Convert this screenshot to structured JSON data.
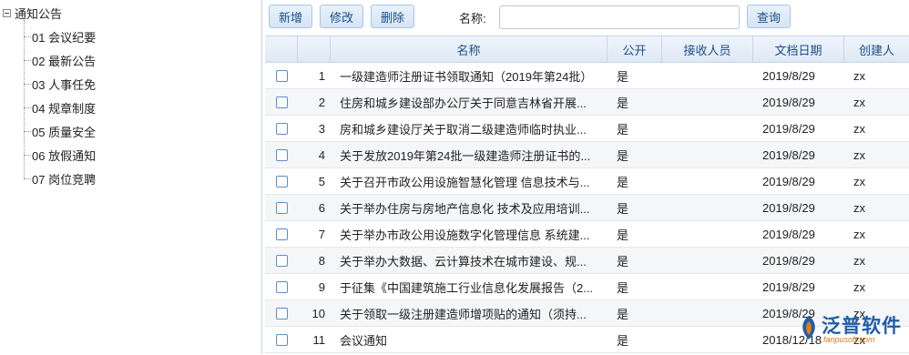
{
  "tree": {
    "root_label": "通知公告",
    "items": [
      "01 会议纪要",
      "02 最新公告",
      "03 人事任免",
      "04 规章制度",
      "05 质量安全",
      "06 放假通知",
      "07 岗位竞聘"
    ]
  },
  "toolbar": {
    "add_label": "新增",
    "edit_label": "修改",
    "delete_label": "删除",
    "name_label": "名称:",
    "name_value": "",
    "query_label": "查询"
  },
  "grid": {
    "columns": [
      "名称",
      "公开",
      "接收人员",
      "文档日期",
      "创建人"
    ],
    "rows": [
      {
        "no": "1",
        "name": "一级建造师注册证书领取通知（2019年第24批）",
        "public": "是",
        "recipients": "",
        "date": "2019/8/29",
        "creator": "zx"
      },
      {
        "no": "2",
        "name": "住房和城乡建设部办公厅关于同意吉林省开展...",
        "public": "是",
        "recipients": "",
        "date": "2019/8/29",
        "creator": "zx"
      },
      {
        "no": "3",
        "name": "房和城乡建设厅关于取消二级建造师临时执业...",
        "public": "是",
        "recipients": "",
        "date": "2019/8/29",
        "creator": "zx"
      },
      {
        "no": "4",
        "name": "关于发放2019年第24批一级建造师注册证书的...",
        "public": "是",
        "recipients": "",
        "date": "2019/8/29",
        "creator": "zx"
      },
      {
        "no": "5",
        "name": "关于召开市政公用设施智慧化管理 信息技术与...",
        "public": "是",
        "recipients": "",
        "date": "2019/8/29",
        "creator": "zx"
      },
      {
        "no": "6",
        "name": "关于举办住房与房地产信息化 技术及应用培训...",
        "public": "是",
        "recipients": "",
        "date": "2019/8/29",
        "creator": "zx"
      },
      {
        "no": "7",
        "name": "关于举办市政公用设施数字化管理信息 系统建...",
        "public": "是",
        "recipients": "",
        "date": "2019/8/29",
        "creator": "zx"
      },
      {
        "no": "8",
        "name": "关于举办大数据、云计算技术在城市建设、规...",
        "public": "是",
        "recipients": "",
        "date": "2019/8/29",
        "creator": "zx"
      },
      {
        "no": "9",
        "name": "于征集《中国建筑施工行业信息化发展报告（2...",
        "public": "是",
        "recipients": "",
        "date": "2019/8/29",
        "creator": "zx"
      },
      {
        "no": "10",
        "name": "关于领取一级注册建造师增项贴的通知（须持...",
        "public": "是",
        "recipients": "",
        "date": "2019/8/29",
        "creator": "zx"
      },
      {
        "no": "11",
        "name": "会议通知",
        "public": "是",
        "recipients": "",
        "date": "2018/12/18",
        "creator": "zx"
      }
    ]
  },
  "watermark": {
    "brand": "泛普软件",
    "url": "fanpusoft.com",
    "color": "#1e5da9"
  }
}
